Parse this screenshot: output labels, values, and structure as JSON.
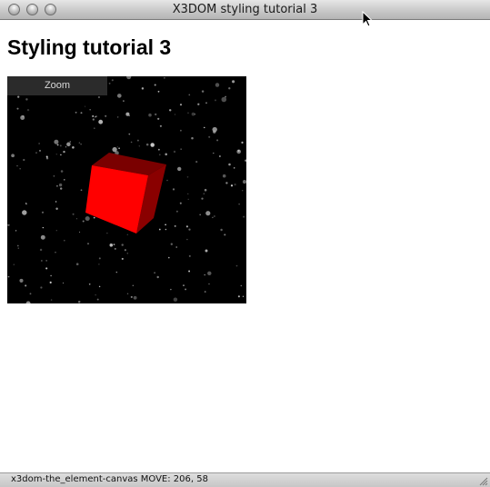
{
  "window": {
    "title": "X3DOM styling tutorial 3"
  },
  "page": {
    "heading": "Styling tutorial 3"
  },
  "x3d": {
    "zoom_label": "Zoom",
    "background_color": "#000000",
    "cube_front_color": "#ff0000",
    "cube_side_color": "#8a0000",
    "cube_top_color": "#7a0000"
  },
  "status": {
    "text": "x3dom-the_element-canvas MOVE: 206, 58"
  }
}
